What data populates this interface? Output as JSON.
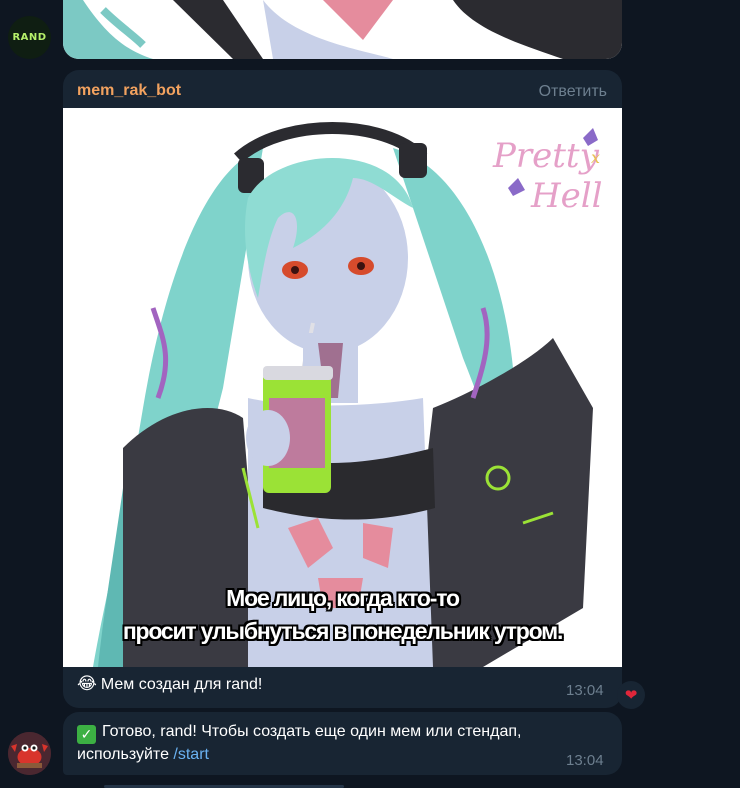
{
  "chat": {
    "avatars": {
      "rand_label": "RAND",
      "bot_avatar": "crab-avatar"
    },
    "message": {
      "sender": "mem_rak_bot",
      "reply_label": "Ответить",
      "meme_caption_line1": "Мое лицо, когда кто-то",
      "meme_caption_line2": "просит улыбнуться в понедельник утром.",
      "watermark_line1": "Pretty",
      "watermark_line2": "Hell",
      "watermark_x": "x",
      "text": "Мем создан для rand!",
      "emoji": "😂",
      "time": "13:04",
      "reaction": "❤"
    },
    "bot_message": {
      "check_icon": "✓",
      "text_before": "Готово, rand! Чтобы создать еще один мем или стендап, используйте ",
      "link": "/start",
      "time": "13:04"
    }
  },
  "colors": {
    "background": "#0e1621",
    "bubble": "#182533",
    "sender": "#f2a25f",
    "muted": "#6d7f8f",
    "link": "#6ab2f2"
  }
}
